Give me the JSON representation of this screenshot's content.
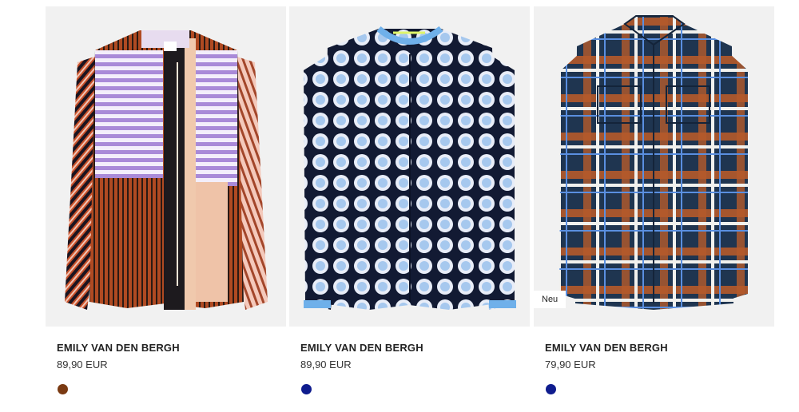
{
  "products": [
    {
      "brand": "EMILY VAN DEN BERGH",
      "price": "89,90 EUR",
      "badge": "",
      "swatch_color": "#7a3a12",
      "image": "multicolor-striped-blouse"
    },
    {
      "brand": "EMILY VAN DEN BERGH",
      "price": "89,90 EUR",
      "badge": "",
      "swatch_color": "#0f1c8e",
      "image": "navy-dotted-blouse"
    },
    {
      "brand": "EMILY VAN DEN BERGH",
      "price": "79,90 EUR",
      "badge": "Neu",
      "swatch_color": "#0f1c8e",
      "image": "plaid-shirt"
    }
  ]
}
